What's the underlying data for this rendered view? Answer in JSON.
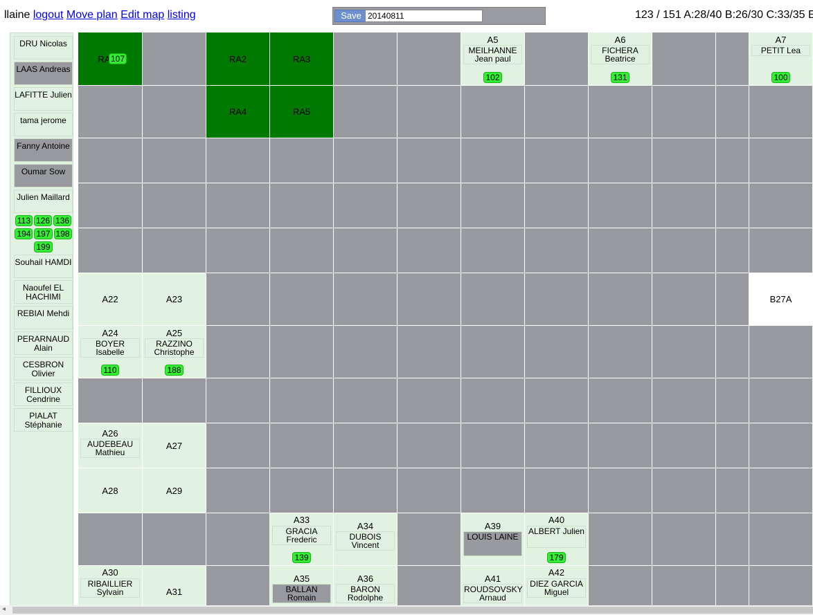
{
  "header": {
    "username": "llaine",
    "links": [
      "logout",
      "Move plan",
      "Edit map",
      "listing"
    ],
    "save_label": "Save",
    "date_value": "20140811",
    "stats": "123 / 151 A:28/40 B:26/30 C:33/35 E"
  },
  "sidebar": {
    "people": [
      {
        "name": "DRU Nicolas",
        "grey": false
      },
      {
        "name": "LAAS Andreas",
        "grey": true
      },
      {
        "name": "LAFITTE Julien",
        "grey": false
      },
      {
        "name": "tama jerome",
        "grey": false
      },
      {
        "name": "Fanny Antoine",
        "grey": true
      },
      {
        "name": "Oumar Sow",
        "grey": true
      },
      {
        "name": "Julien Maillard",
        "grey": false
      },
      {
        "name": "Souhail HAMDI",
        "grey": false
      },
      {
        "name": "Naoufel EL HACHIMI",
        "grey": false
      },
      {
        "name": "REBIAI Mehdi",
        "grey": false
      },
      {
        "name": "PERARNAUD Alain",
        "grey": false
      },
      {
        "name": "CESBRON Olivier",
        "grey": false
      },
      {
        "name": "FILLIOUX Cendrine",
        "grey": false
      },
      {
        "name": "PIALAT Stéphanie",
        "grey": false
      }
    ],
    "badge_rows": [
      [
        "113",
        "126",
        "136"
      ],
      [
        "194",
        "197",
        "198"
      ],
      [
        "199"
      ]
    ]
  },
  "desks": {
    "RA1": {
      "label": "RA1",
      "badge": "107"
    },
    "RA2": {
      "label": "RA2"
    },
    "RA3": {
      "label": "RA3"
    },
    "RA4": {
      "label": "RA4"
    },
    "RA5": {
      "label": "RA5"
    },
    "A5": {
      "label": "A5",
      "occupant": "MEILHANNE Jean paul",
      "badge": "102"
    },
    "A6": {
      "label": "A6",
      "occupant": "FICHERA Beatrice",
      "badge": "131"
    },
    "A7": {
      "label": "A7",
      "occupant": "PETIT Lea",
      "badge": "100"
    },
    "A22": {
      "label": "A22"
    },
    "A23": {
      "label": "A23"
    },
    "B27A": {
      "label": "B27A"
    },
    "A24": {
      "label": "A24",
      "occupant": "BOYER Isabelle",
      "badge": "110"
    },
    "A25": {
      "label": "A25",
      "occupant": "RAZZINO Christophe",
      "badge": "188"
    },
    "A26": {
      "label": "A26",
      "occupant": "AUDEBEAU Mathieu"
    },
    "A27": {
      "label": "A27"
    },
    "A28": {
      "label": "A28"
    },
    "A29": {
      "label": "A29"
    },
    "A33": {
      "label": "A33",
      "occupant": "GRACIA Frederic",
      "badge": "139"
    },
    "A34": {
      "label": "A34",
      "occupant": "DUBOIS Vincent"
    },
    "A39": {
      "label": "A39",
      "occupant": "LOUIS LAINE"
    },
    "A40": {
      "label": "A40",
      "occupant": "ALBERT Julien",
      "badge": "179"
    },
    "A30": {
      "label": "A30",
      "occupant": "RIBAILLIER Sylvain"
    },
    "A31": {
      "label": "A31"
    },
    "A35": {
      "label": "A35",
      "occupant": "BALLAN Romain"
    },
    "A36": {
      "label": "A36",
      "occupant": "BARON Rodolphe"
    },
    "A41": {
      "label": "A41",
      "occupant": "ROUDSOVSKY Arnaud"
    },
    "A42": {
      "label": "A42",
      "occupant": "DIEZ GARCIA Miguel"
    }
  }
}
